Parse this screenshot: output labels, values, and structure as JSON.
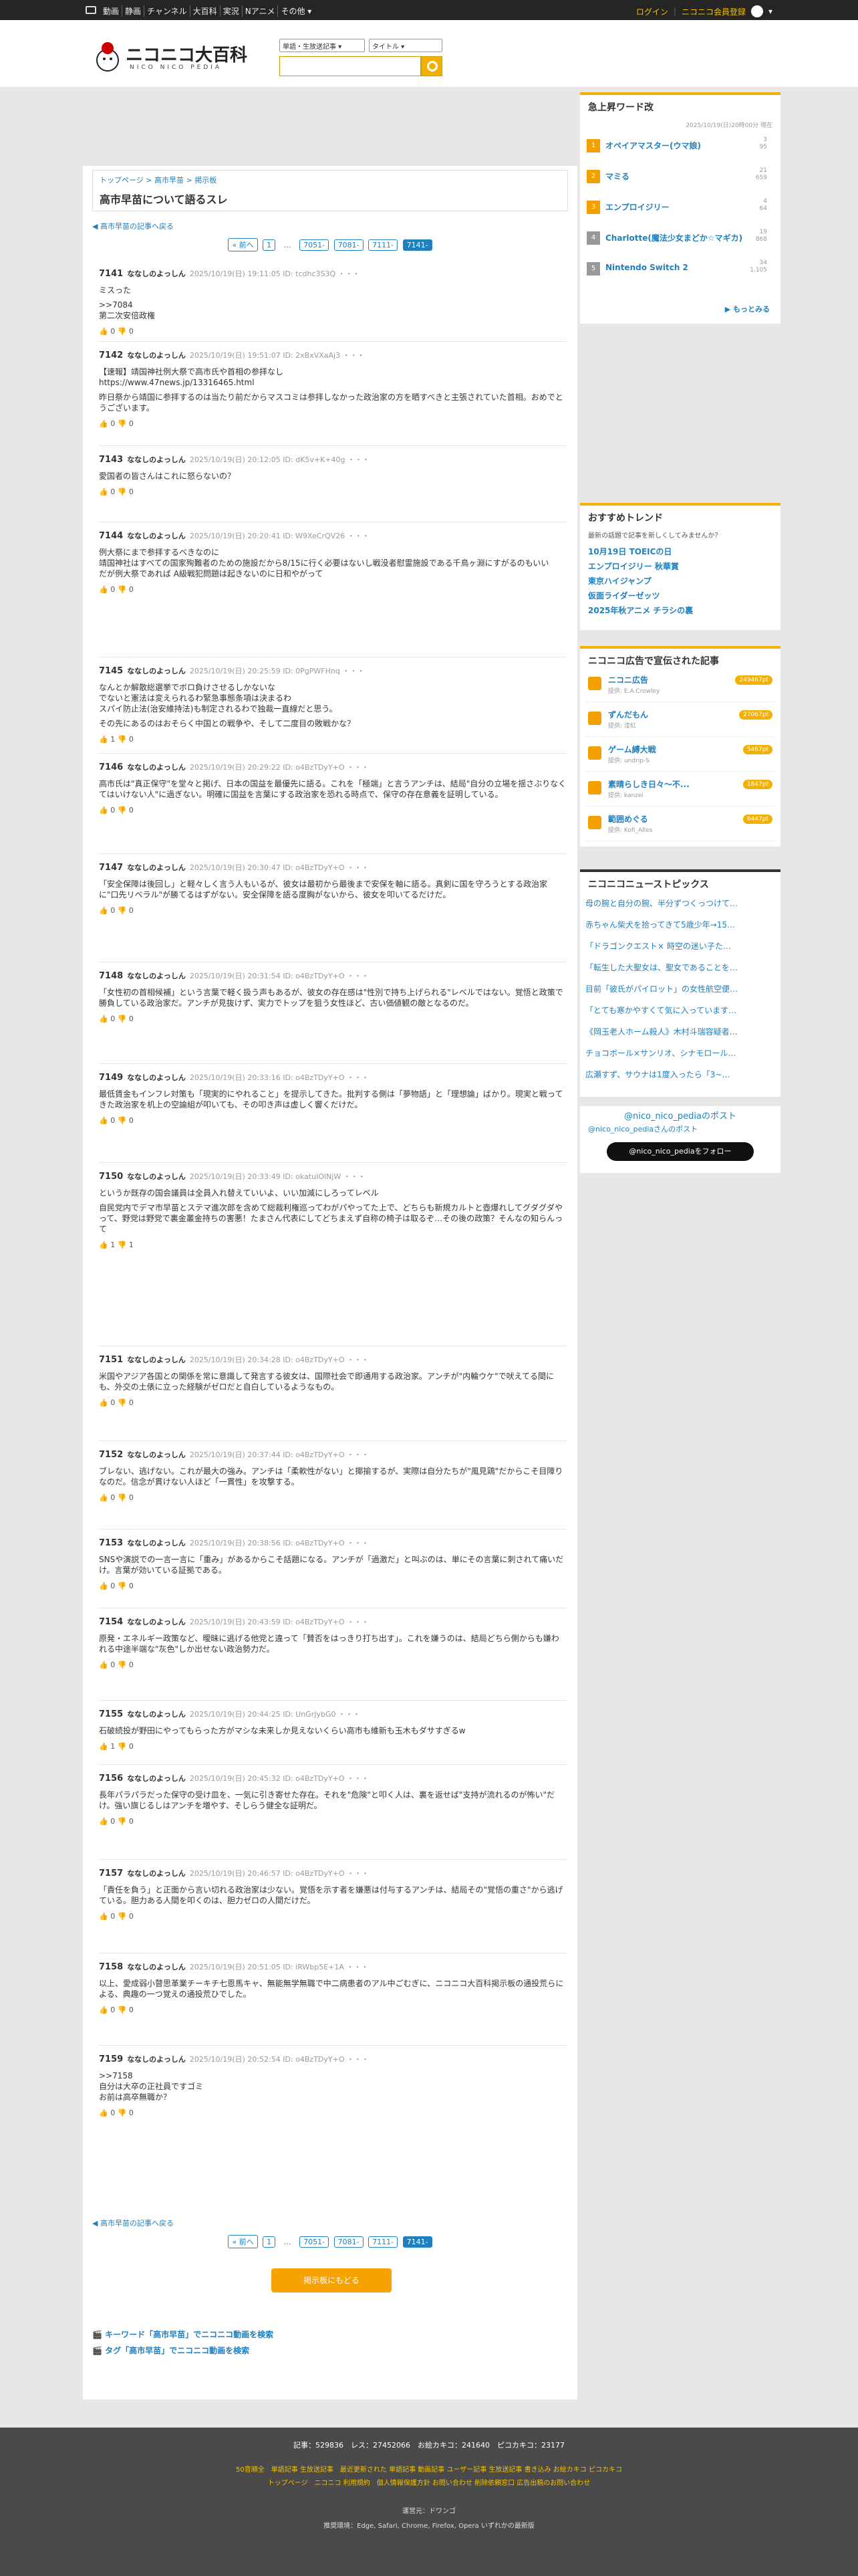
{
  "topbar": {
    "nav": [
      "動画",
      "静画",
      "チャンネル",
      "大百科",
      "実況",
      "Nアニメ",
      "その他 ▾"
    ],
    "login": "ログイン",
    "register": "ニコニコ会員登録"
  },
  "logo": {
    "title": "ニコニコ大百科",
    "sub": "NICO NICO PEDIA"
  },
  "search": {
    "select1": "単語・生放送記事 ▾",
    "select2": "タイトル ▾"
  },
  "breadcrumb": "トップページ > 高市早苗 > 掲示板",
  "page_title": "高市早苗について語るスレ",
  "back_link": "◀ 高市早苗の記事へ戻る",
  "pager": {
    "prev": "« 前へ",
    "first": "1",
    "dots": "…",
    "p1": "7051-",
    "p2": "7081-",
    "p3": "7111-",
    "cur": "7141-"
  },
  "posts": [
    {
      "no": "7141",
      "name": "ななしのよっしん",
      "meta": "2025/10/19(日) 19:11:05 ID: tcdhc3S3Q ・・・",
      "body": [
        "ミスった",
        ">>7084\n第二次安倍政権"
      ],
      "votes": "👍 0 👎 0"
    },
    {
      "no": "7142",
      "name": "ななしのよっしん",
      "meta": "2025/10/19(日) 19:51:07 ID: 2xBxVXaAj3 ・・・",
      "body": [
        "【速報】靖国神社例大祭で高市氏や首相の参拝なし\nhttps://www.47news.jp/13316465.html",
        "昨日祭から靖国に参拝するのは当たり前だからマスコミは参拝しなかった政治家の方を晒すべきと主張されていた首相。おめでとうございます。"
      ],
      "votes": "👍 0 👎 0"
    },
    {
      "no": "7143",
      "name": "ななしのよっしん",
      "meta": "2025/10/19(日) 20:12:05 ID: dK5v+K+40g ・・・",
      "body": [
        "愛国者の皆さんはこれに怒らないの？"
      ],
      "votes": "👍 0 👎 0"
    },
    {
      "no": "7144",
      "name": "ななしのよっしん",
      "meta": "2025/10/19(日) 20:20:41 ID: W9XeCrQV26 ・・・",
      "body": [
        "例大祭にまで参拝するべきなのに\n靖国神社はすべての国家殉難者のための施設だから8/15に行く必要はないし戦没者慰霊施設である千鳥ヶ淵にすがるのもいい\nだが例大祭であれば A級戦犯問題は起きないのに日和やがって"
      ],
      "votes": "👍 0 👎 0"
    },
    {
      "no": "7145",
      "name": "ななしのよっしん",
      "meta": "2025/10/19(日) 20:25:59 ID: 0PgPWFHnq ・・・",
      "body": [
        "なんとか解散総選挙でボロ負けさせるしかないな\nでないと憲法は変えられるわ緊急事態条項は決まるわ\nスパイ防止法(治安維持法)も制定されるわで独裁一直線だと思う。",
        "その先にあるのはおそらく中国との戦争や、そして二度目の敗戦かな？"
      ],
      "votes": "👍 1 👎 0"
    },
    {
      "no": "7146",
      "name": "ななしのよっしん",
      "meta": "2025/10/19(日) 20:29:22 ID: o4BzTDyY+O ・・・",
      "body": [
        "高市氏は\"真正保守\"を堂々と掲げ、日本の国益を最優先に語る。これを「極端」と言うアンチは、結局\"自分の立場を揺さぶりなくてはいけない人\"に過ぎない。明確に国益を言葉にする政治家を恐れる時点で、保守の存在意義を証明している。"
      ],
      "votes": "👍 0 👎 0"
    },
    {
      "no": "7147",
      "name": "ななしのよっしん",
      "meta": "2025/10/19(日) 20:30:47 ID: o4BzTDyY+O ・・・",
      "body": [
        "「安全保障は後回し」と軽々しく言う人もいるが、彼女は最初から最後まで安保を軸に語る。真剣に国を守ろうとする政治家に\"口先リベラル\"が勝てるはずがない。安全保障を語る度胸がないから、彼女を叩いてるだけだ。"
      ],
      "votes": "👍 0 👎 0"
    },
    {
      "no": "7148",
      "name": "ななしのよっしん",
      "meta": "2025/10/19(日) 20:31:54 ID: o4BzTDyY+O ・・・",
      "body": [
        "「女性初の首相候補」という言葉で軽く扱う声もあるが、彼女の存在感は\"性別で持ち上げられる\"レベルではない。覚悟と政策で勝負している政治家だ。アンチが見抜けず、実力でトップを狙う女性ほど、古い価値観の敵となるのだ。"
      ],
      "votes": "👍 0 👎 0"
    },
    {
      "no": "7149",
      "name": "ななしのよっしん",
      "meta": "2025/10/19(日) 20:33:16 ID: o4BzTDyY+O ・・・",
      "body": [
        "最低賃金もインフレ対策も「現実的にやれること」を提示してきた。批判する側は「夢物語」と「理想論」ばかり。現実と戦ってきた政治家を机上の空論組が叩いても、その叩き声は虚しく響くだけだ。"
      ],
      "votes": "👍 0 👎 0"
    },
    {
      "no": "7150",
      "name": "ななしのよっしん",
      "meta": "2025/10/19(日) 20:33:49 ID: okatuIOlNjW ・・・",
      "body": [
        "というか既存の国会議員は全員入れ替えていいよ、いい加減にしろってレベル",
        "自民党内でデマ市早苗とステマ進次郎を含めて総裁利権巡ってわがパやってた上で、どちらも新規カルトと壺爆れしてグダグダやって、野党は野党で裏金叢金持ちの害悪！たまさん代表にしてどちまえず自称の椅子は取るぞ…その後の政策？そんなの知らんって"
      ],
      "votes": "👍 1 👎 1"
    },
    {
      "no": "7151",
      "name": "ななしのよっしん",
      "meta": "2025/10/19(日) 20:34:28 ID: o4BzTDyY+O ・・・",
      "body": [
        "米国やアジア各国との関係を常に意識して発言する彼女は、国際社会で即通用する政治家。アンチが\"内輪ウケ\"で吠えてる間にも、外交の土俵に立った経験がゼロだと自白しているようなもの。"
      ],
      "votes": "👍 0 👎 0"
    },
    {
      "no": "7152",
      "name": "ななしのよっしん",
      "meta": "2025/10/19(日) 20:37:44 ID: o4BzTDyY+O ・・・",
      "body": [
        "ブレない、逃げない。これが最大の強み。アンチは「柔軟性がない」と揶揄するが、実際は自分たちが\"風見鶏\"だからこそ目障りなのだ。信念が貫けない人ほど「一貫性」を攻撃する。"
      ],
      "votes": "👍 0 👎 0"
    },
    {
      "no": "7153",
      "name": "ななしのよっしん",
      "meta": "2025/10/19(日) 20:38:56 ID: o4BzTDyY+O ・・・",
      "body": [
        "SNSや演説での一言一言に「重み」があるからこそ話題になる。アンチが「過激だ」と叫ぶのは、単にその言葉に刺されて痛いだけ。言葉が効いている証拠である。"
      ],
      "votes": "👍 0 👎 0"
    },
    {
      "no": "7154",
      "name": "ななしのよっしん",
      "meta": "2025/10/19(日) 20:43:59 ID: o4BzTDyY+O ・・・",
      "body": [
        "原発・エネルギー政策など、曖昧に逃げる他党と違って「賛否をはっきり打ち出す」。これを嫌うのは、結局どちら側からも嫌われる中途半端な\"灰色\"しか出せない政治勢力だ。"
      ],
      "votes": "👍 0 👎 0"
    },
    {
      "no": "7155",
      "name": "ななしのよっしん",
      "meta": "2025/10/19(日) 20:44:25 ID: UnGrJybG0 ・・・",
      "body": [
        "石破続投が野田にやってもらった方がマシな未来しか見えないくらい高市も維新も玉木もダサすぎるw"
      ],
      "votes": "👍 1 👎 0"
    },
    {
      "no": "7156",
      "name": "ななしのよっしん",
      "meta": "2025/10/19(日) 20:45:32 ID: o4BzTDyY+O ・・・",
      "body": [
        "長年パラパラだった保守の受け皿を、一気に引き寄せた存在。それを\"危険\"と叩く人は、裏を返せば\"支持が流れるのが怖い\"だけ。強い旗じるしはアンチを増やす、そしらう健全な証明だ。"
      ],
      "votes": "👍 0 👎 0"
    },
    {
      "no": "7157",
      "name": "ななしのよっしん",
      "meta": "2025/10/19(日) 20:46:57 ID: o4BzTDyY+O ・・・",
      "body": [
        "「責任を負う」と正面から言い切れる政治家は少ない。覚悟を示す者を嫌悪は付与するアンチは、結局その\"覚悟の重さ\"から逃げている。胆力ある人間を叩くのは、胆力ゼロの人間だけだ。"
      ],
      "votes": "👍 0 👎 0"
    },
    {
      "no": "7158",
      "name": "ななしのよっしん",
      "meta": "2025/10/19(日) 20:51:05 ID: iRWbp5E+1A ・・・",
      "body": [
        "以上、愛成弱小瞽思革業チーキチ七恩馬キャ、無能無学無職で中二病患者のアル中ごむぎに、ニコニコ大百科掲示板の通投荒らによる、典趣の一つ覚えの通投荒ひでした。"
      ],
      "votes": "👍 0 👎 0"
    },
    {
      "no": "7159",
      "name": "ななしのよっしん",
      "meta": "2025/10/19(日) 20:52:54 ID: o4BzTDyY+O ・・・",
      "body": [
        ">>7158\n自分は大卒の正社員ですゴミ\nお前は高卒無職か？"
      ],
      "votes": "👍 0 👎 0"
    }
  ],
  "show_board": "掲示板にもどる",
  "foot_links": [
    "キーワード「高市早苗」でニコニコ動画を検索",
    "タグ「高市早苗」でニコニコ動画を検索"
  ],
  "side": {
    "rising": {
      "title": "急上昇ワード改",
      "date": "2025/10/19(日)20時00分 現在",
      "items": [
        {
          "n": "1",
          "t": "オペイアマスター(ウマ娘)",
          "c1": "3",
          "c2": "95"
        },
        {
          "n": "2",
          "t": "マミる",
          "c1": "21",
          "c2": "659"
        },
        {
          "n": "3",
          "t": "エンプロイ⁠ジリー",
          "c1": "4",
          "c2": "64"
        },
        {
          "n": "4",
          "t": "Charlotte(魔法少女まどか☆マギカ)",
          "c1": "19",
          "c2": "868"
        },
        {
          "n": "5",
          "t": "Nintendo Switch 2",
          "c1": "34",
          "c2": "1,105"
        }
      ],
      "more": "▶ もっとみる"
    },
    "trend": {
      "title": "おすすめトレンド",
      "note": "最新の話題で記事を新しくしてみませんか？",
      "lines": [
        "10月19日 TOEICの日",
        "エンプロイジリー 秋華賞",
        "東京ハイジャンプ",
        "仮面ライダーゼッツ",
        "2025年秋アニメ チラシの裏"
      ]
    },
    "ads": {
      "title": "ニコニコ広告で宣伝された記事",
      "items": [
        {
          "t": "ニコニ広告",
          "s": "提供: E.A.Crowley",
          "p": "249467pt"
        },
        {
          "t": "ずんだもん",
          "s": "提供: 漆紅",
          "p": "27067pt"
        },
        {
          "t": "ゲーム縛大戦",
          "s": "提供: undrip-S",
          "p": "5467pt"
        },
        {
          "t": "素晴らしき日々～不...",
          "s": "提供: kanzei",
          "p": "1847pt"
        },
        {
          "t": "範囲めぐる",
          "s": "提供: Kofi_Alles",
          "p": "6447pt"
        }
      ]
    },
    "news": {
      "title": "ニコニコニューストピックス",
      "items": [
        "母の腕と自分の腕、半分ずつくっつけて…",
        "赤ちゃん柴犬を拾ってきて5歳少年→15…",
        "「ドラゴンクエスト× 時空の迷い子た…",
        "「転生した大聖女は、聖女であることを…",
        "目前「彼氏がパイロット」の女性航空便…",
        "「とても寒かやすくて気に入っています…",
        "《岡玉老人ホーム殺人》木村斗瑞容疑者…",
        "チョコボール×サンリオ、シナモロール…",
        "広瀬すず、サウナは1度入ったら「3~…"
      ]
    },
    "x": {
      "title": "@nico_nico_pediaのポスト",
      "sub": "@nico_nico_pediaさんのポスト",
      "follow": "@nico_nico_pediaをフォロー"
    }
  },
  "footer": {
    "stats": "記事：529836　レス：27452066　お絵カキコ：241640　ピコカキコ：23177",
    "l1": "50音順全　単語記事 生放送記事　最近更新された 単語記事 動画記事 ユーザー記事 生放送記事 書き込み お絵カキコ ピコカキコ",
    "l2": "トップページ　ニコニコ 利用規約　個人情報保護方針 お問い合わせ 削除依頼窓口 広告出稿のお問い合わせ",
    "op": "運営元：ドワンゴ",
    "browser": "推奨環境：Edge, Safari, Chrome, Firefox, Opera いずれかの最新版"
  }
}
